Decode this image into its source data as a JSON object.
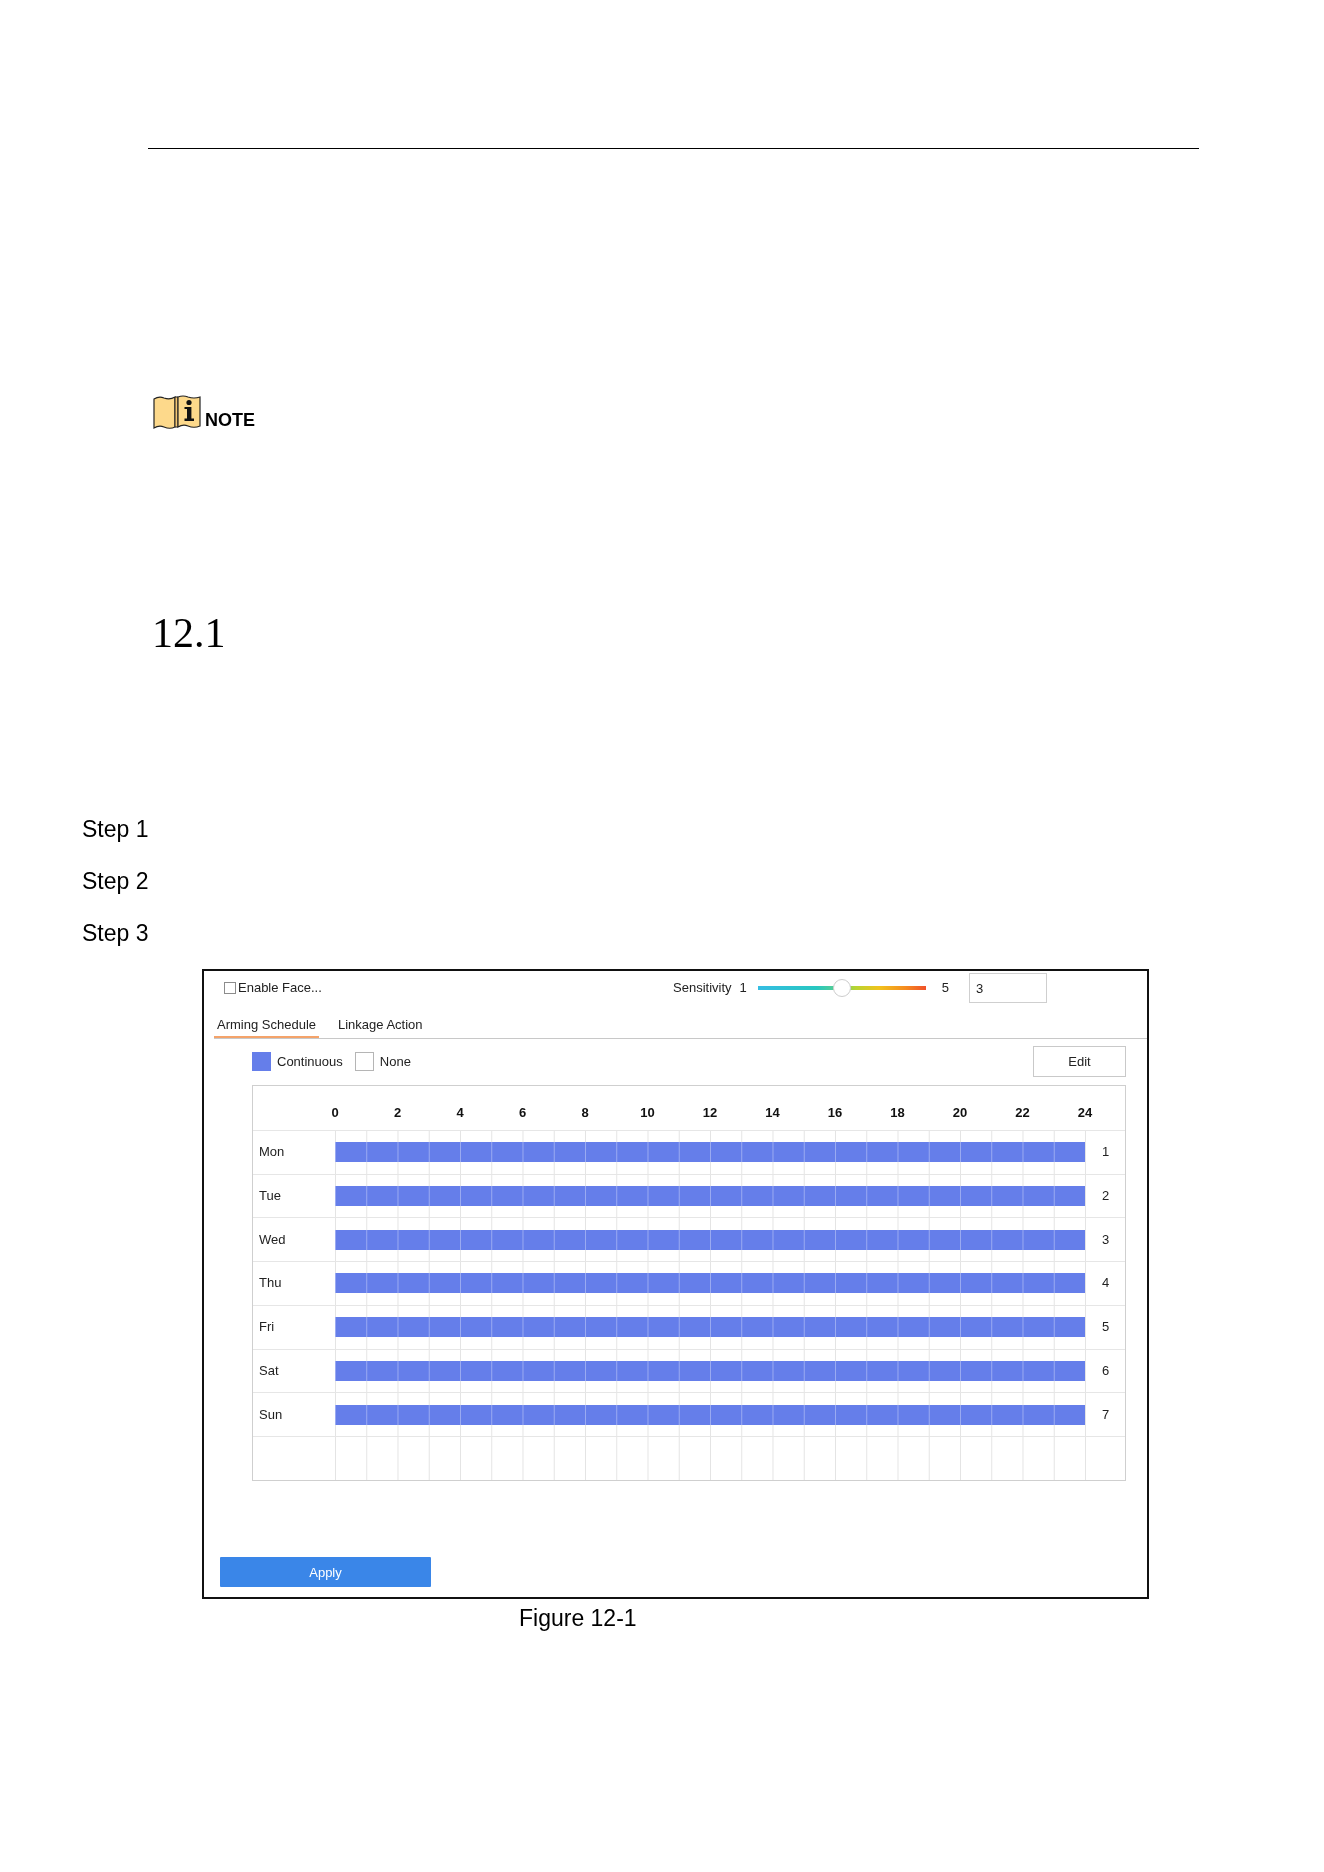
{
  "note": {
    "label": "NOTE"
  },
  "section": {
    "number": "12.1"
  },
  "steps": [
    {
      "label": "Step 1"
    },
    {
      "label": "Step 2"
    },
    {
      "label": "Step 3"
    }
  ],
  "figure": {
    "enable": {
      "label": "Enable Face...",
      "checked": false
    },
    "sensitivity": {
      "label": "Sensitivity",
      "min_label": "1",
      "max_label": "5",
      "level": 0.5,
      "value": "3"
    },
    "tabs": [
      {
        "label": "Arming Schedule",
        "selected": true
      },
      {
        "label": "Linkage Action",
        "selected": false
      }
    ],
    "legend": [
      {
        "kind": "continuous",
        "label": "Continuous",
        "color": "#657eea"
      },
      {
        "kind": "none",
        "label": "None",
        "color": "#ffffff"
      }
    ],
    "edit_button": "Edit",
    "schedule": {
      "hours": [
        "0",
        "2",
        "4",
        "6",
        "8",
        "10",
        "12",
        "14",
        "16",
        "18",
        "20",
        "22",
        "24"
      ],
      "days": [
        {
          "name": "Mon",
          "number": "1",
          "kind": "continuous",
          "level": 1
        },
        {
          "name": "Tue",
          "number": "2",
          "kind": "continuous",
          "level": 1
        },
        {
          "name": "Wed",
          "number": "3",
          "kind": "continuous",
          "level": 1
        },
        {
          "name": "Thu",
          "number": "4",
          "kind": "continuous",
          "level": 1
        },
        {
          "name": "Fri",
          "number": "5",
          "kind": "continuous",
          "level": 1
        },
        {
          "name": "Sat",
          "number": "6",
          "kind": "continuous",
          "level": 1
        },
        {
          "name": "Sun",
          "number": "7",
          "kind": "continuous",
          "level": 1
        }
      ]
    },
    "apply_button": "Apply"
  },
  "caption": "Figure 12-1"
}
